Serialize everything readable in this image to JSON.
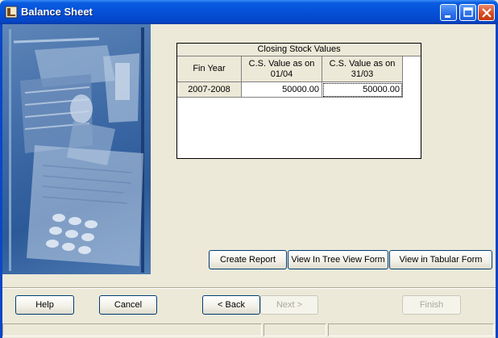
{
  "window": {
    "title": "Balance Sheet"
  },
  "grid": {
    "caption": "Closing Stock Values",
    "columns": [
      "Fin Year",
      "C.S. Value as on 01/04",
      "C.S. Value as on 31/03"
    ],
    "rows": [
      {
        "fin_year": "2007-2008",
        "cs_open": "50000.00",
        "cs_close": "50000.00"
      }
    ]
  },
  "actions": {
    "create_report": "Create Report",
    "tree_view": "View In Tree View Form",
    "tabular": "View in Tabular Form"
  },
  "footer": {
    "help": "Help",
    "cancel": "Cancel",
    "back": "< Back",
    "next": "Next >",
    "finish": "Finish"
  }
}
